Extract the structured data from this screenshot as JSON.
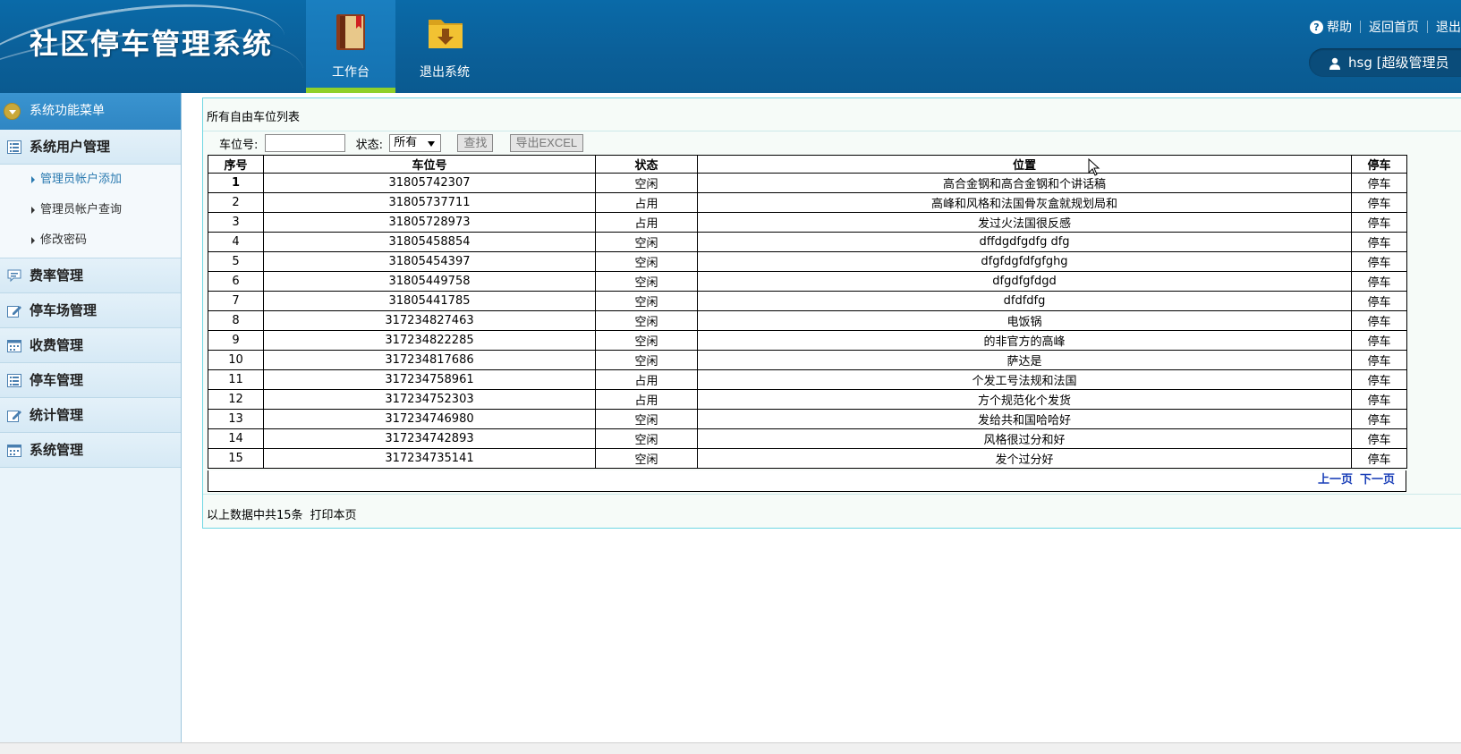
{
  "header": {
    "app_title": "社区停车管理系统",
    "nav": [
      {
        "label": "工作台",
        "icon": "book-icon",
        "active": true
      },
      {
        "label": "退出系统",
        "icon": "folder-download-icon",
        "active": false
      }
    ],
    "links": {
      "help": "帮助",
      "home": "返回首页",
      "logout": "退出"
    },
    "user": "hsg [超级管理员"
  },
  "sidebar": {
    "menu_title": "系统功能菜单",
    "groups": [
      {
        "label": "系统用户管理",
        "icon": "list-icon"
      },
      {
        "label": "费率管理",
        "icon": "chat-icon"
      },
      {
        "label": "停车场管理",
        "icon": "edit-icon"
      },
      {
        "label": "收费管理",
        "icon": "calendar-icon"
      },
      {
        "label": "停车管理",
        "icon": "list-icon"
      },
      {
        "label": "统计管理",
        "icon": "edit-icon"
      },
      {
        "label": "系统管理",
        "icon": "calendar-icon"
      }
    ],
    "sub_items": [
      "管理员帐户添加",
      "管理员帐户查询",
      "修改密码"
    ]
  },
  "panel": {
    "title": "所有自由车位列表",
    "search": {
      "spot_label": "车位号:",
      "spot_value": "",
      "status_label": "状态:",
      "status_value": "所有",
      "search_button": "查找",
      "export_button": "导出EXCEL"
    },
    "columns": [
      "序号",
      "车位号",
      "状态",
      "位置",
      "停车"
    ],
    "rows": [
      {
        "no": "1",
        "spot": "31805742307",
        "status": "空闲",
        "location": "高合金钢和高合金钢和个讲话稿",
        "action": "停车"
      },
      {
        "no": "2",
        "spot": "31805737711",
        "status": "占用",
        "location": "高峰和风格和法国骨灰盒就规划局和",
        "action": "停车"
      },
      {
        "no": "3",
        "spot": "31805728973",
        "status": "占用",
        "location": "发过火法国很反感",
        "action": "停车"
      },
      {
        "no": "4",
        "spot": "31805458854",
        "status": "空闲",
        "location": "dffdgdfgdfg dfg",
        "action": "停车"
      },
      {
        "no": "5",
        "spot": "31805454397",
        "status": "空闲",
        "location": "dfgfdgfdfgfghg",
        "action": "停车"
      },
      {
        "no": "6",
        "spot": "31805449758",
        "status": "空闲",
        "location": "dfgdfgfdgd",
        "action": "停车"
      },
      {
        "no": "7",
        "spot": "31805441785",
        "status": "空闲",
        "location": "dfdfdfg",
        "action": "停车"
      },
      {
        "no": "8",
        "spot": "317234827463",
        "status": "空闲",
        "location": "电饭锅",
        "action": "停车"
      },
      {
        "no": "9",
        "spot": "317234822285",
        "status": "空闲",
        "location": "的非官方的高峰",
        "action": "停车"
      },
      {
        "no": "10",
        "spot": "317234817686",
        "status": "空闲",
        "location": "萨达是",
        "action": "停车"
      },
      {
        "no": "11",
        "spot": "317234758961",
        "status": "占用",
        "location": "个发工号法规和法国",
        "action": "停车"
      },
      {
        "no": "12",
        "spot": "317234752303",
        "status": "占用",
        "location": "方个规范化个发货",
        "action": "停车"
      },
      {
        "no": "13",
        "spot": "317234746980",
        "status": "空闲",
        "location": "发给共和国哈哈好",
        "action": "停车"
      },
      {
        "no": "14",
        "spot": "317234742893",
        "status": "空闲",
        "location": "风格很过分和好",
        "action": "停车"
      },
      {
        "no": "15",
        "spot": "317234735141",
        "status": "空闲",
        "location": "发个过分好",
        "action": "停车"
      }
    ],
    "pager": {
      "prev": "上一页",
      "next": "下一页"
    },
    "summary": {
      "count_text": "以上数据中共15条",
      "print": "打印本页"
    }
  },
  "colors": {
    "header": "#0b5f98",
    "accent_green": "#8fd02a",
    "panel_border": "#6fd6e3",
    "link_blue": "#1a3fb8"
  }
}
